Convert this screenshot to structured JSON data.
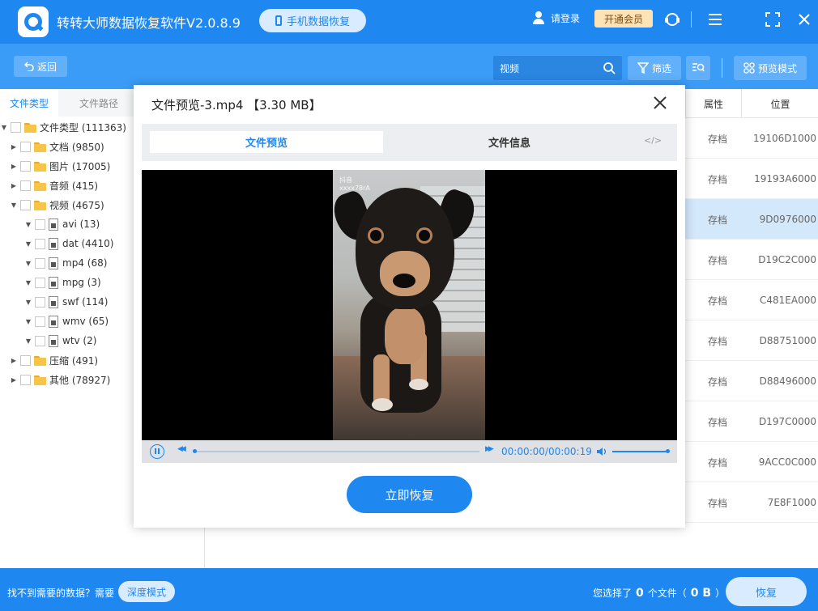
{
  "titlebar": {
    "app_title": "转转大师数据恢复软件V2.0.8.9",
    "phone_recovery": "手机数据恢复",
    "login": "请登录",
    "vip": "开通会员"
  },
  "toolbar": {
    "back": "返回",
    "search_value": "视频",
    "filter": "筛选",
    "preview_mode": "预览模式"
  },
  "left_panel": {
    "tabs": [
      "文件类型",
      "文件路径"
    ],
    "tree": [
      {
        "label": "文件类型 (111363)",
        "level": 0,
        "kind": "folder",
        "expanded": true
      },
      {
        "label": "文档 (9850)",
        "level": 1,
        "kind": "folder",
        "expanded": false
      },
      {
        "label": "图片 (17005)",
        "level": 1,
        "kind": "folder",
        "expanded": false
      },
      {
        "label": "音频 (415)",
        "level": 1,
        "kind": "folder",
        "expanded": false
      },
      {
        "label": "视频 (4675)",
        "level": 1,
        "kind": "folder",
        "expanded": true
      },
      {
        "label": "avi (13)",
        "level": 2,
        "kind": "file",
        "expanded": true
      },
      {
        "label": "dat (4410)",
        "level": 2,
        "kind": "file",
        "expanded": true
      },
      {
        "label": "mp4 (68)",
        "level": 2,
        "kind": "file",
        "expanded": true
      },
      {
        "label": "mpg (3)",
        "level": 2,
        "kind": "file",
        "expanded": true
      },
      {
        "label": "swf (114)",
        "level": 2,
        "kind": "file",
        "expanded": true
      },
      {
        "label": "wmv (65)",
        "level": 2,
        "kind": "file",
        "expanded": true
      },
      {
        "label": "wtv (2)",
        "level": 2,
        "kind": "file",
        "expanded": true
      },
      {
        "label": "压缩 (491)",
        "level": 1,
        "kind": "folder",
        "expanded": false
      },
      {
        "label": "其他 (78927)",
        "level": 1,
        "kind": "folder",
        "expanded": false
      }
    ]
  },
  "list": {
    "headers": [
      "属性",
      "位置"
    ],
    "rows": [
      {
        "attr": "存档",
        "pos": "19106D1000"
      },
      {
        "attr": "存档",
        "pos": "19193A6000"
      },
      {
        "attr": "存档",
        "pos": "9D0976000"
      },
      {
        "attr": "存档",
        "pos": "D19C2C000"
      },
      {
        "attr": "存档",
        "pos": "C481EA000"
      },
      {
        "attr": "存档",
        "pos": "D88751000"
      },
      {
        "attr": "存档",
        "pos": "D88496000"
      },
      {
        "attr": "存档",
        "pos": "D197C0000"
      },
      {
        "attr": "存档",
        "pos": "9ACC0C000"
      },
      {
        "attr": "存档",
        "pos": "7E8F1000"
      }
    ]
  },
  "modal": {
    "title": "文件预览-3.mp4 【3.30 MB】",
    "tab_preview": "文件预览",
    "tab_info": "文件信息",
    "code": "</>",
    "watermark_app": "抖音",
    "watermark_id": "xxxx78rA",
    "time": "00:00:00/00:00:19",
    "restore": "立即恢复"
  },
  "bottombar": {
    "not_found": "找不到需要的数据？需要",
    "deep_mode": "深度模式",
    "selected_prefix": "您选择了",
    "selected_count": "0",
    "selected_mid": "个文件（",
    "selected_size": "0 B",
    "selected_suffix": "）",
    "recover": "恢复"
  },
  "colors": {
    "primary": "#1f87f0",
    "toolbar": "#3b9cf7",
    "selected_row": "#d4e8fc",
    "vip_bg": "#fde3b5"
  }
}
